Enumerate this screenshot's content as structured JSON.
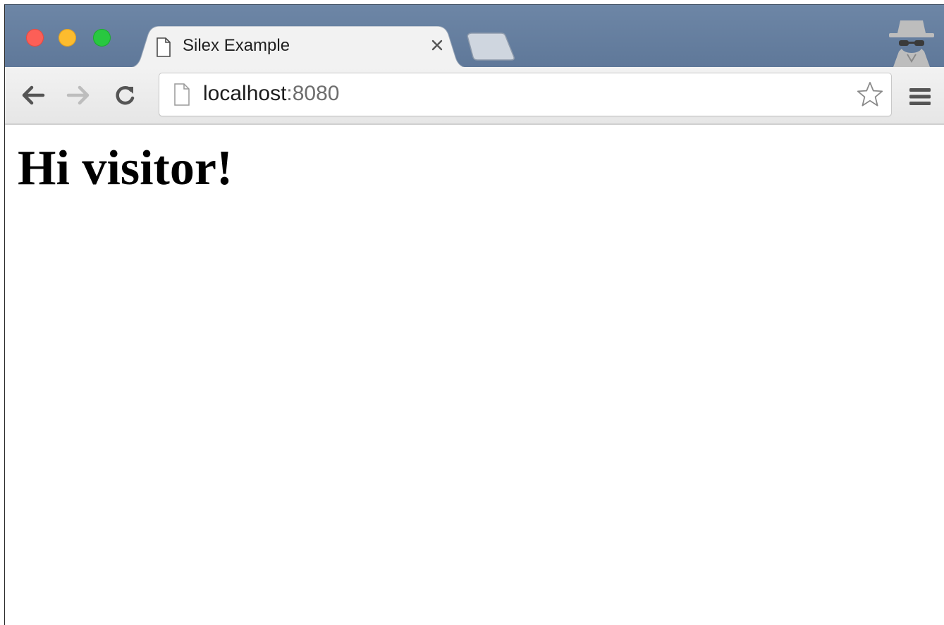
{
  "browser": {
    "tab": {
      "title": "Silex Example",
      "close_icon": "close-icon",
      "page_icon": "document-icon"
    },
    "new_tab_icon": "new-tab-icon",
    "incognito_icon": "incognito-icon",
    "traffic_lights": {
      "close": "#fc5f57",
      "minimize": "#fdbc2e",
      "zoom": "#28c840"
    },
    "titlebar_color": "#6580a1",
    "toolbar": {
      "back_icon": "arrow-left-icon",
      "forward_icon": "arrow-right-icon",
      "reload_icon": "reload-icon",
      "menu_icon": "hamburger-menu-icon",
      "bookmark_icon": "star-icon"
    },
    "address_bar": {
      "host": "localhost",
      "port": ":8080"
    }
  },
  "page": {
    "heading": "Hi visitor!"
  }
}
